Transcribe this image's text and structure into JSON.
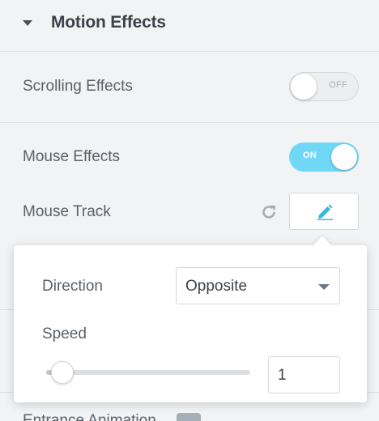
{
  "section": {
    "title": "Motion Effects",
    "caret_icon": "caret-down-icon"
  },
  "rows": {
    "scrolling": {
      "label": "Scrolling Effects",
      "switch_text": "OFF",
      "state": "off"
    },
    "mouse": {
      "label": "Mouse Effects",
      "switch_text": "ON",
      "state": "on"
    },
    "mouse_track": {
      "label": "Mouse Track",
      "reset_icon": "reset-icon",
      "edit_icon": "pencil-icon"
    }
  },
  "popover": {
    "direction": {
      "label": "Direction",
      "value": "Opposite"
    },
    "speed": {
      "label": "Speed",
      "value": "1",
      "slider_fraction": 0.0
    }
  },
  "partial": {
    "label": "Entrance Animation"
  },
  "colors": {
    "accent": "#71d7f7",
    "text": "#495157",
    "background": "#f1f3f5"
  }
}
